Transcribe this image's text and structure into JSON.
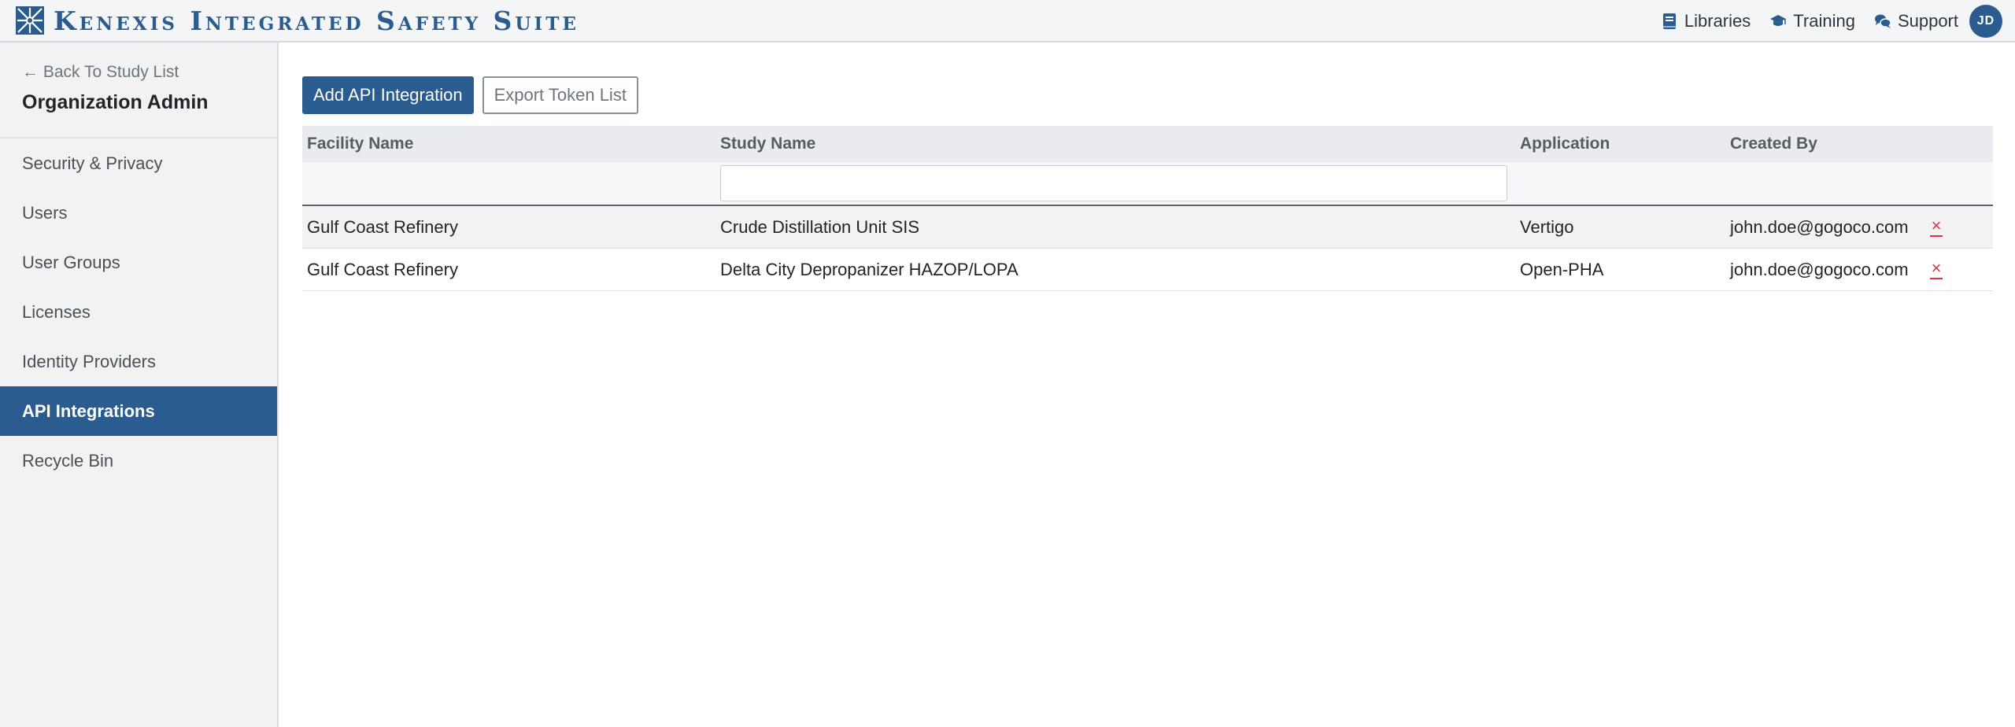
{
  "header": {
    "app_title": "Kenexis Integrated Safety Suite",
    "links": [
      {
        "label": "Libraries",
        "icon": "book-icon"
      },
      {
        "label": "Training",
        "icon": "graduation-cap-icon"
      },
      {
        "label": "Support",
        "icon": "chat-bubbles-icon"
      }
    ],
    "user_initials": "JD",
    "brand_color": "#2a5c8f"
  },
  "sidebar": {
    "back_label": "← Back To Study List",
    "title": "Organization Admin",
    "items": [
      {
        "label": "Security & Privacy",
        "active": false
      },
      {
        "label": "Users",
        "active": false
      },
      {
        "label": "User Groups",
        "active": false
      },
      {
        "label": "Licenses",
        "active": false
      },
      {
        "label": "Identity Providers",
        "active": false
      },
      {
        "label": "API Integrations",
        "active": true
      },
      {
        "label": "Recycle Bin",
        "active": false
      }
    ]
  },
  "toolbar": {
    "add_label": "Add API Integration",
    "export_label": "Export Token List"
  },
  "table": {
    "columns": [
      "Facility Name",
      "Study Name",
      "Application",
      "Created By"
    ],
    "filter_value": "",
    "rows": [
      {
        "facility": "Gulf Coast Refinery",
        "study": "Crude Distillation Unit SIS",
        "application": "Vertigo",
        "created_by": "john.doe@gogoco.com",
        "delete_label": "×"
      },
      {
        "facility": "Gulf Coast Refinery",
        "study": "Delta City Depropanizer HAZOP/LOPA",
        "application": "Open-PHA",
        "created_by": "john.doe@gogoco.com",
        "delete_label": "×"
      }
    ]
  }
}
